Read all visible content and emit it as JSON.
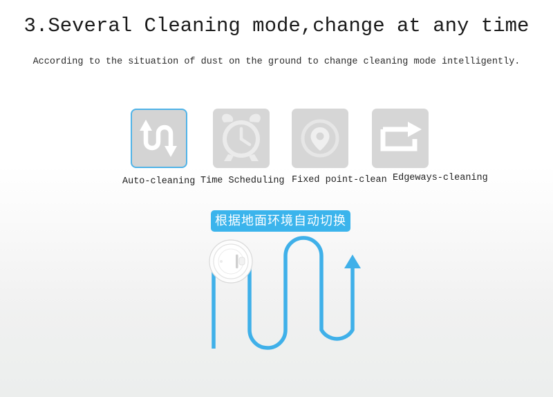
{
  "page": {
    "background_top": "#ffffff",
    "background_bottom": "#eceeed"
  },
  "heading": {
    "title": "3.Several Cleaning mode,change at any time",
    "subtitle": "According to the situation of dust on the ground to change cleaning mode intelligently."
  },
  "modes": {
    "accent_color": "#4fb3e8",
    "tile_color": "#d6d6d6",
    "items": [
      {
        "label": "Auto-cleaning",
        "icon": "zigzag-arrows-icon",
        "selected": true
      },
      {
        "label": "Time Scheduling",
        "icon": "alarm-clock-icon",
        "selected": false
      },
      {
        "label": "Fixed point-clean",
        "icon": "location-pin-circle-icon",
        "selected": false
      },
      {
        "label": "Edgeways-cleaning",
        "icon": "loop-arrow-icon",
        "selected": false
      }
    ]
  },
  "badge": {
    "text": "根据地面环境自动切换",
    "color": "#3bb4ec",
    "text_color": "#ffffff"
  },
  "diagram": {
    "path_color": "#3fb0e9",
    "robot_name": "robot-vacuum",
    "description": "serpentine cleaning path with upward arrow"
  }
}
